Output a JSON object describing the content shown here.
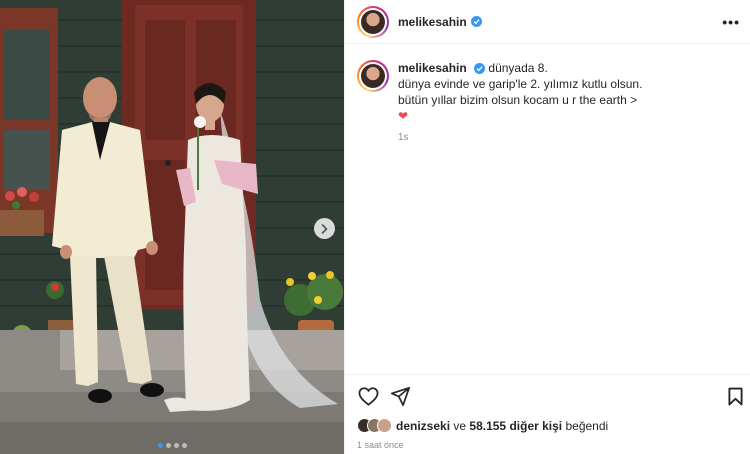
{
  "post": {
    "username": "melikesahin",
    "more_label": "•••",
    "caption_location": "dünyada 8.",
    "caption_line1": "dünya evinde ve garip'le 2. yılımız kutlu olsun.",
    "caption_line2": "bütün yıllar bizim olsun kocam u r the earth >",
    "caption_heart": "❤",
    "caption_time": "1s"
  },
  "likes": {
    "liker": "denizseki",
    "connector": "ve",
    "count": "58.155 diğer kişi",
    "suffix": "beğendi"
  },
  "posted_ago": "1 saat önce",
  "carousel": {
    "total": 4,
    "active": 0
  },
  "colors": {
    "verified": "#3897f0",
    "heart": "#ed4956",
    "muted": "#8e8e8e"
  },
  "icons": [
    "verified-badge-icon",
    "more-options-icon",
    "heart-icon",
    "share-icon",
    "bookmark-icon",
    "chevron-right-icon"
  ]
}
